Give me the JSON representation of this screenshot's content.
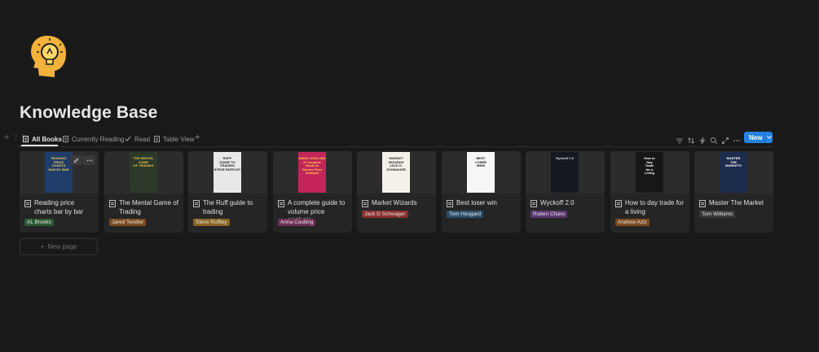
{
  "page": {
    "title": "Knowledge Base",
    "icon": "lightbulb-head-icon"
  },
  "views": {
    "tabs": [
      {
        "label": "All Books",
        "icon": "doc-icon",
        "active": true
      },
      {
        "label": "Currently Reading",
        "icon": "doc-icon",
        "active": false
      },
      {
        "label": "Read",
        "icon": "check-icon",
        "active": false
      },
      {
        "label": "Table View",
        "icon": "doc-icon",
        "active": false
      }
    ],
    "add_view": "+"
  },
  "toolbar": {
    "tools": [
      "filter-icon",
      "sort-icon",
      "lightning-icon",
      "search-icon",
      "expand-icon",
      "more-icon"
    ],
    "new_label": "New"
  },
  "cards": [
    {
      "title": "Reading price charts bar by bar",
      "author": "AL Brooks",
      "tag_color": "#2b5a33",
      "cover_bg": "#1f3d6b",
      "cover_text": [
        "READING",
        "PRICE",
        "CHARTS",
        "BAR BY BAR"
      ],
      "cover_fg": "#f2c94c"
    },
    {
      "title": "The Mental Game of Trading",
      "author": "Jared Tendler",
      "tag_color": "#7a4a1f",
      "cover_bg": "#2d3a2a",
      "cover_text": [
        "THE MENTAL GAME",
        "OF TRADING"
      ],
      "cover_fg": "#e7c24a"
    },
    {
      "title": "The Ruff guide to trading",
      "author": "Steve Ruffley",
      "tag_color": "#8a6420",
      "cover_bg": "#e8e8e8",
      "cover_text": [
        "RUFF",
        "GUIDE TO",
        "TRADING",
        "STEVE RUFFLEY"
      ],
      "cover_fg": "#222222"
    },
    {
      "title": "A complete guide to volume price analysis",
      "author": "Anna Coulling",
      "tag_color": "#6e2f57",
      "cover_bg": "#c4245a",
      "cover_text": [
        "ANNA COULLING",
        "A Complete Guide to",
        "Volume Price",
        "Analysis"
      ],
      "cover_fg": "#f5d14a"
    },
    {
      "title": "Market Wizards",
      "author": "Jack D Schwager",
      "tag_color": "#8b2f2f",
      "cover_bg": "#f4f1ea",
      "cover_text": [
        "MARKET",
        "WIZARDS",
        "JACK D. SCHWAGER"
      ],
      "cover_fg": "#2a2a2a"
    },
    {
      "title": "Best loser win",
      "author": "Tom Hougard",
      "tag_color": "#2c4f6b",
      "cover_bg": "#f7f7f7",
      "cover_text": [
        "BEST",
        "LOSER",
        "WINS"
      ],
      "cover_fg": "#111111"
    },
    {
      "title": "Wyckoff 2.0",
      "author": "Ruben Chavs",
      "tag_color": "#5a3570",
      "cover_bg": "#141821",
      "cover_text": [
        "Wyckoff 2.0"
      ],
      "cover_fg": "#d9d9d9"
    },
    {
      "title": "How to day trade for a living",
      "author": "Andrew Aziz",
      "tag_color": "#7a4a1f",
      "cover_bg": "#171717",
      "cover_text": [
        "How to",
        "Day",
        "Trade",
        "for a",
        "Living"
      ],
      "cover_fg": "#ffffff"
    },
    {
      "title": "Master The Market",
      "author": "Tom Williams",
      "tag_color": "#3a3a3a",
      "cover_bg": "#1c2c4d",
      "cover_text": [
        "MASTER",
        "THE",
        "MARKETS"
      ],
      "cover_fg": "#ffffff"
    }
  ],
  "new_page_label": "New page",
  "colors": {
    "background": "#191919",
    "card": "#252525",
    "accent": "#2383e2"
  }
}
